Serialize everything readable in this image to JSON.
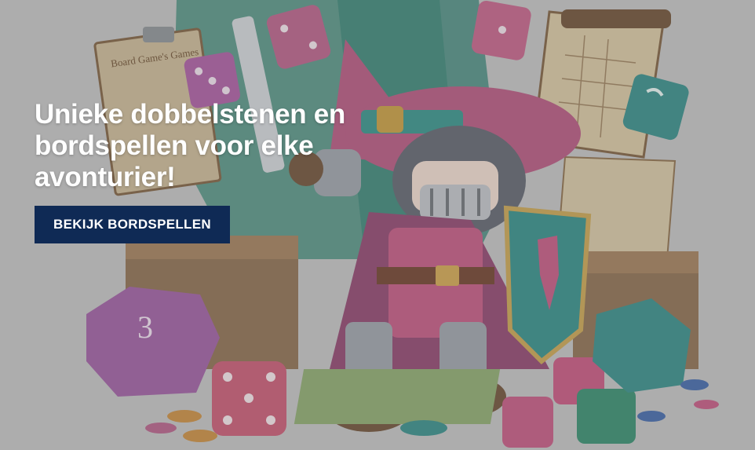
{
  "hero": {
    "title": "Unieke dobbelstenen en bordspellen voor elke avonturier!",
    "cta_label": "BEKIJK BORDSPELLEN",
    "cta_color": "#0f2a55",
    "illustration_icon": "wizard-knight-illustration",
    "illustration_texts": {
      "clipboard_heading": "Board Game's Games"
    }
  }
}
